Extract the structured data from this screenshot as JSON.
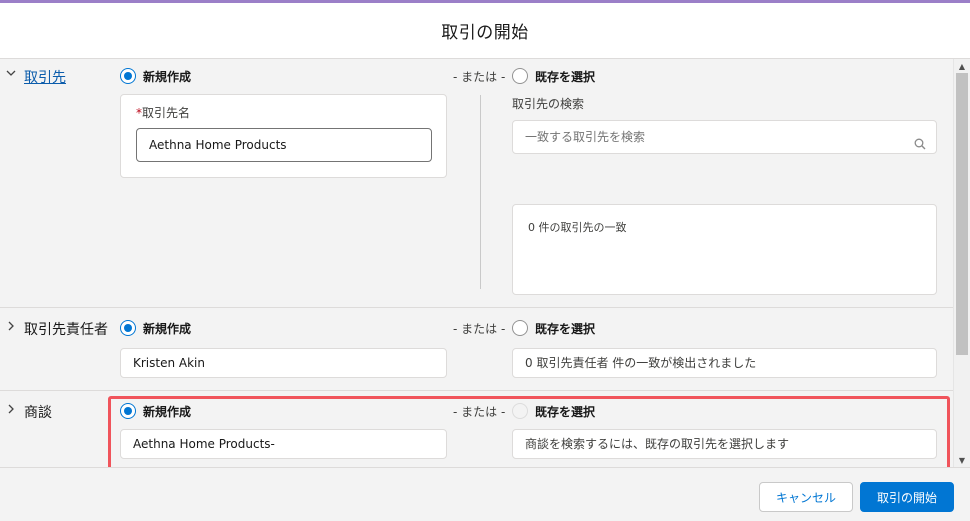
{
  "modal": {
    "title": "取引の開始"
  },
  "or_text": "- または -",
  "new_label": "新規作成",
  "existing_label": "既存を選択",
  "account": {
    "title": "取引先",
    "required_mark": "*",
    "field_label": "取引先名",
    "field_value": "Aethna Home Products",
    "search_label": "取引先の検索",
    "search_placeholder": "一致する取引先を検索",
    "results_text": "0 件の取引先の一致"
  },
  "contact": {
    "title": "取引先責任者",
    "field_value": "Kristen Akin",
    "match_text": "0 取引先責任者 件の一致が検出されました"
  },
  "opportunity": {
    "title": "商談",
    "field_value": "Aethna Home Products-",
    "hint_text": "商談を検索するには、既存の取引先を選択します"
  },
  "footer": {
    "cancel_label": "キャンセル",
    "convert_label": "取引の開始"
  },
  "colors": {
    "brand": "#0176d3",
    "highlight": "#f0545b",
    "link": "#0b5cab"
  }
}
